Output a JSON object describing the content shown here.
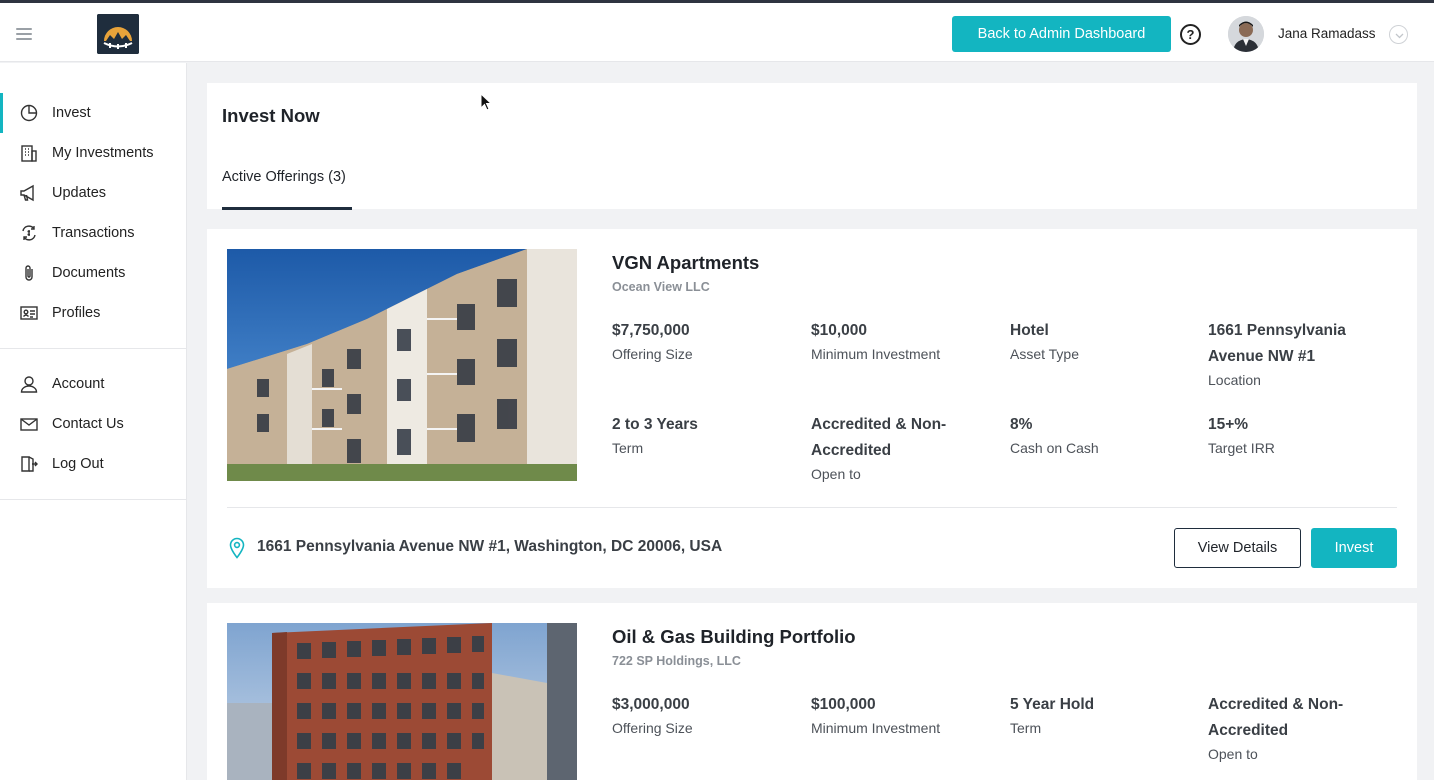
{
  "header": {
    "admin_button": "Back to Admin Dashboard",
    "help": "?",
    "user_name": "Jana Ramadass"
  },
  "sidebar": {
    "items": [
      {
        "label": "Invest",
        "icon": "pie-chart-icon",
        "active": true
      },
      {
        "label": "My Investments",
        "icon": "building-icon"
      },
      {
        "label": "Updates",
        "icon": "megaphone-icon"
      },
      {
        "label": "Transactions",
        "icon": "exchange-icon"
      },
      {
        "label": "Documents",
        "icon": "paperclip-icon"
      },
      {
        "label": "Profiles",
        "icon": "id-card-icon"
      },
      {
        "label": "Account",
        "icon": "user-icon"
      },
      {
        "label": "Contact Us",
        "icon": "envelope-icon"
      },
      {
        "label": "Log Out",
        "icon": "logout-icon"
      }
    ]
  },
  "main": {
    "title": "Invest Now",
    "tabs": [
      {
        "label": "Active Offerings (3)",
        "active": true
      }
    ]
  },
  "offerings": [
    {
      "name": "VGN Apartments",
      "sponsor": "Ocean View LLC",
      "stats": [
        {
          "value": "$7,750,000",
          "label": "Offering Size"
        },
        {
          "value": "$10,000",
          "label": "Minimum Investment"
        },
        {
          "value": "Hotel",
          "label": "Asset Type"
        },
        {
          "value": "1661 Pennsylvania Avenue NW #1",
          "label": "Location"
        },
        {
          "value": "2 to 3 Years",
          "label": "Term"
        },
        {
          "value": "Accredited & Non-Accredited",
          "label": "Open to"
        },
        {
          "value": "8%",
          "label": "Cash on Cash"
        },
        {
          "value": "15+%",
          "label": "Target IRR"
        }
      ],
      "address": "1661 Pennsylvania Avenue NW #1, Washington, DC 20006, USA",
      "view_button": "View Details",
      "invest_button": "Invest"
    },
    {
      "name": "Oil & Gas Building Portfolio",
      "sponsor": "722 SP Holdings, LLC",
      "stats": [
        {
          "value": "$3,000,000",
          "label": "Offering Size"
        },
        {
          "value": "$100,000",
          "label": "Minimum Investment"
        },
        {
          "value": "5 Year Hold",
          "label": "Term"
        },
        {
          "value": "Accredited & Non-Accredited",
          "label": "Open to"
        }
      ]
    }
  ],
  "colors": {
    "accent": "#13b5c1",
    "navy": "#1f2d3d",
    "background": "#f1f2f4"
  }
}
